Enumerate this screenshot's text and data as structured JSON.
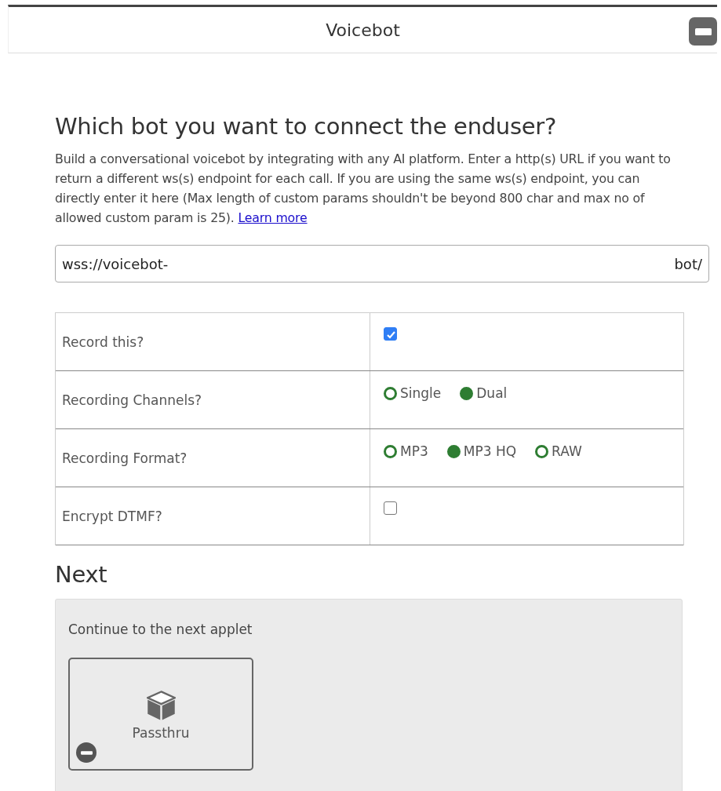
{
  "header": {
    "title": "Voicebot"
  },
  "question": {
    "title": "Which bot you want to connect the enduser?",
    "description": "Build a conversational voicebot by integrating with any AI platform. Enter a http(s) URL if you want to return a different ws(s) endpoint for each call. If you are using the same ws(s) endpoint, you can directly enter it here (Max length of custom params shouldn't be beyond 800 char and max no of allowed custom param is 25).",
    "link": "Learn more"
  },
  "url_field": {
    "value_start": "wss://voicebot-",
    "value_end": "bot/"
  },
  "settings": [
    {
      "label": "Record this?",
      "kind": "checkbox",
      "checked": true
    },
    {
      "label": "Recording Channels?",
      "kind": "radio",
      "options": [
        {
          "label": "Single",
          "selected": false
        },
        {
          "label": "Dual",
          "selected": true
        }
      ]
    },
    {
      "label": "Recording Format?",
      "kind": "radio",
      "options": [
        {
          "label": "MP3",
          "selected": false
        },
        {
          "label": "MP3 HQ",
          "selected": true
        },
        {
          "label": "RAW",
          "selected": false
        }
      ]
    },
    {
      "label": "Encrypt DTMF?",
      "kind": "checkbox",
      "checked": false
    }
  ],
  "next": {
    "title": "Next",
    "hint": "Continue to the next applet",
    "applet": {
      "label": "Passthru"
    }
  }
}
